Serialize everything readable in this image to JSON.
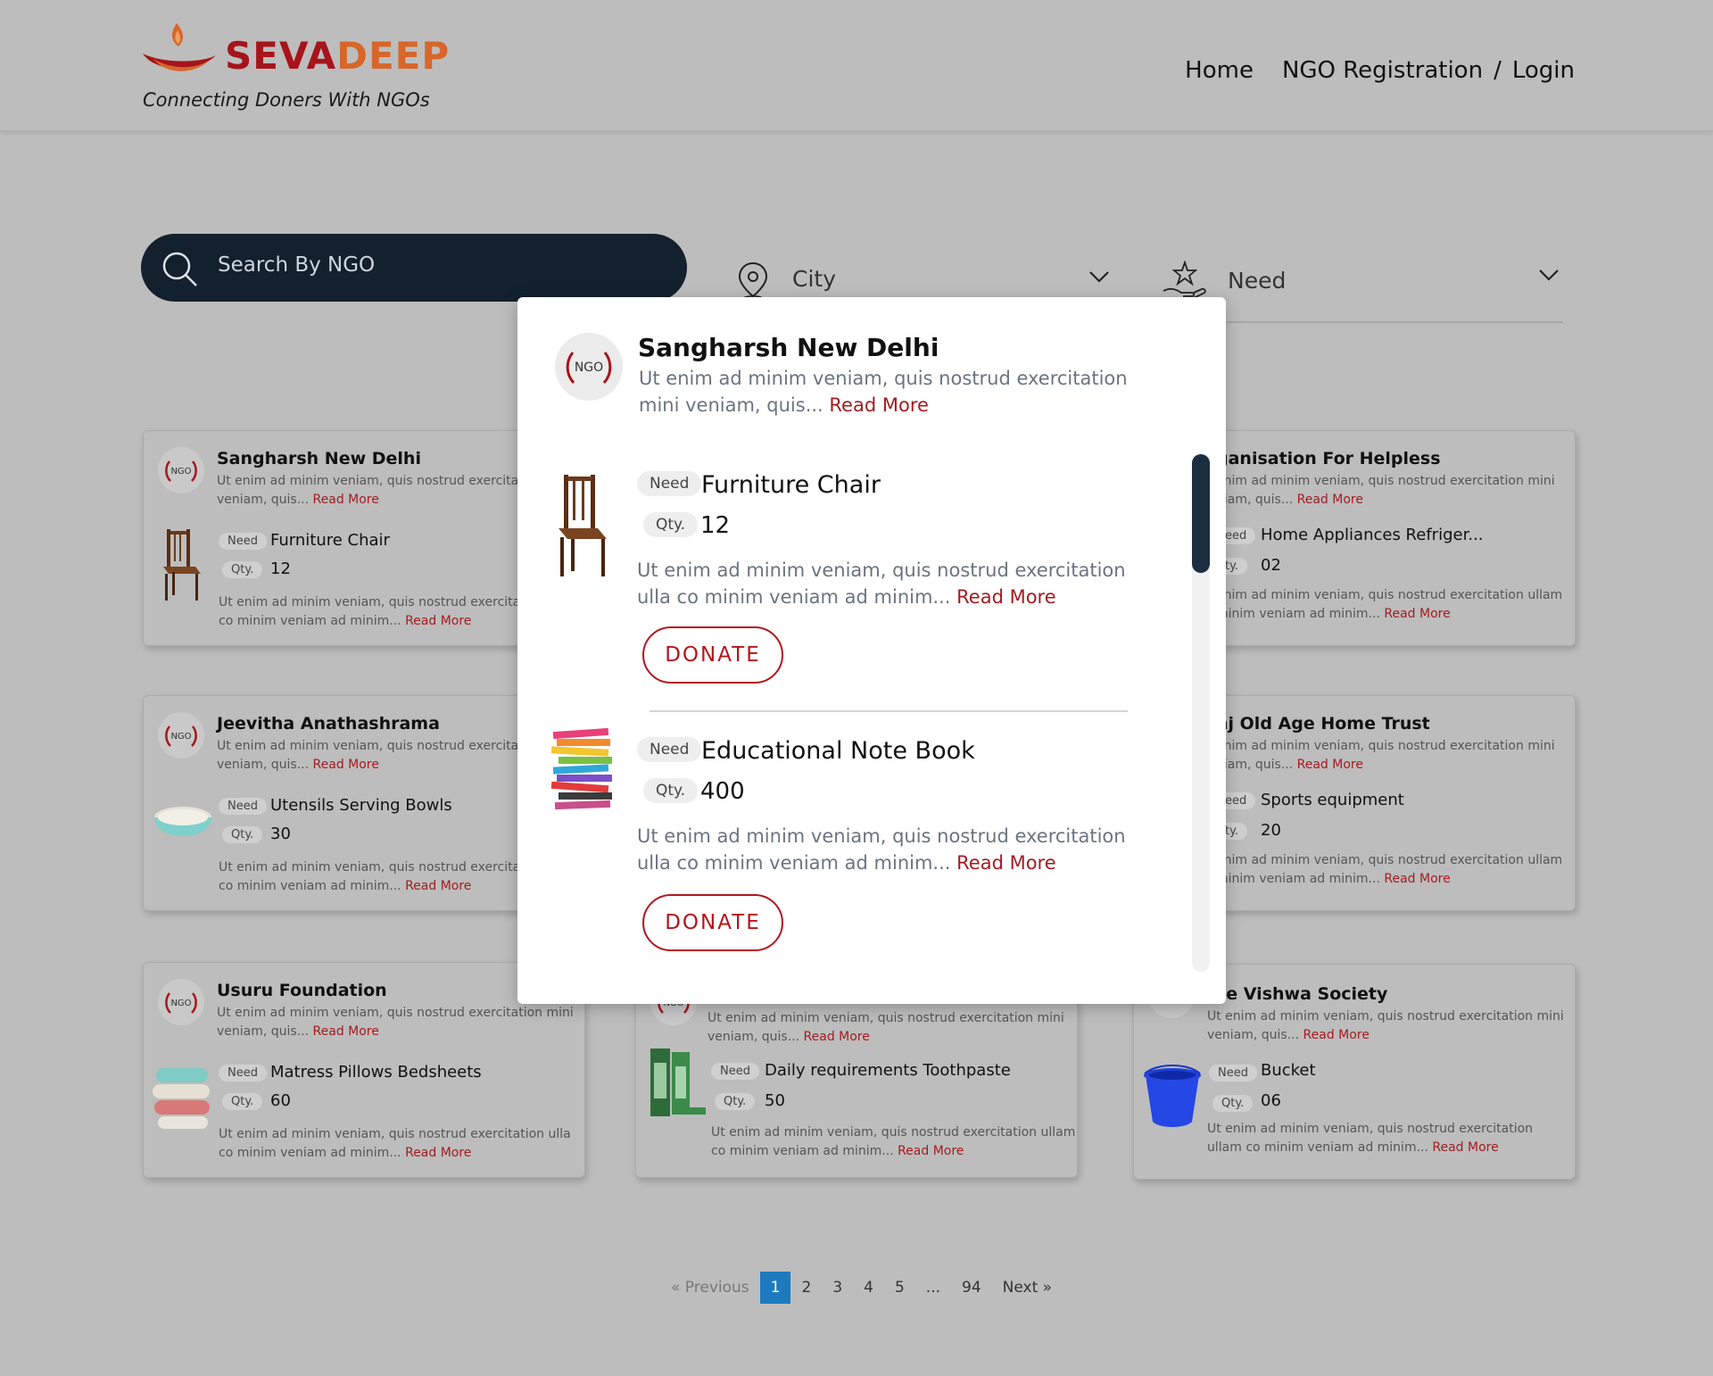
{
  "brand": {
    "word_a": "SEVA",
    "word_b": "DEEP",
    "tagline": "Connecting Doners With NGOs",
    "color_a": "#a7141b",
    "color_b": "#d7662a"
  },
  "nav": {
    "home": "Home",
    "register": "NGO Registration",
    "separator": "/",
    "login": "Login"
  },
  "search": {
    "placeholder": "Search By NGO",
    "icon": "search-icon"
  },
  "filters": {
    "city": "City",
    "need": "Need"
  },
  "badge_text": "NGO",
  "cards": [
    {
      "ngo": "Sangharsh New Delhi",
      "desc": "Ut enim ad minim veniam, quis nostrud exercitation mini veniam, quis...",
      "read_more": "Read More",
      "need_tag": "Need",
      "qty_tag": "Qty.",
      "item": "Furniture Chair",
      "qty": "12",
      "item_desc": "Ut enim ad minim veniam, quis nostrud exercitation ulla co minim veniam ad minim...",
      "item_read_more": "Read More"
    },
    {
      "ngo": "Jeevitha Anathashrama",
      "desc": "Ut enim ad minim veniam, quis nostrud exercitation mini veniam, quis...",
      "read_more": "Read More",
      "need_tag": "Need",
      "qty_tag": "Qty.",
      "item": "Utensils Serving Bowls",
      "qty": "30",
      "item_desc": "Ut enim ad minim veniam, quis nostrud exercitation ulla co minim veniam ad minim...",
      "item_read_more": "Read More"
    },
    {
      "ngo": "Usuru Foundation",
      "desc": "Ut enim ad minim veniam, quis nostrud exercitation mini veniam, quis...",
      "read_more": "Read More",
      "need_tag": "Need",
      "qty_tag": "Qty.",
      "item": "Matress Pillows Bedsheets",
      "qty": "60",
      "item_desc": "Ut enim ad minim veniam, quis nostrud exercitation ulla co minim veniam ad minim...",
      "item_read_more": "Read More"
    },
    {
      "ngo": "",
      "desc": "Ut enim ad minim veniam, quis nostrud exercitation mini veniam, quis...",
      "read_more": "Read More",
      "need_tag": "Need",
      "qty_tag": "Qty.",
      "item": "Daily requirements Toothpaste",
      "qty": "50",
      "item_desc": "Ut enim ad minim veniam, quis nostrud exercitation ullam co minim veniam ad minim...",
      "item_read_more": "Read More"
    },
    {
      "ngo": "ganisation For Helpless",
      "desc": "enim ad minim veniam, quis nostrud exercitation mini niam, quis...",
      "read_more": "Read More",
      "need_tag": "eed",
      "qty_tag": "ty.",
      "item": "Home Appliances Refriger...",
      "qty": "02",
      "item_desc": "enim ad minim veniam, quis nostrud exercitation ullam minim veniam ad minim...",
      "item_read_more": "Read More"
    },
    {
      "ngo": "nj Old Age Home Trust",
      "desc": "enim ad minim veniam, quis nostrud exercitation mini niam, quis...",
      "read_more": "Read More",
      "need_tag": "eed",
      "qty_tag": "ty.",
      "item": "Sports equipment",
      "qty": "20",
      "item_desc": "enim ad minim veniam, quis nostrud exercitation ullam minim veniam ad minim...",
      "item_read_more": "Read More"
    },
    {
      "ngo": "se Vishwa Society",
      "desc": "Ut enim ad minim veniam, quis nostrud exercitation mini veniam, quis...",
      "read_more": "Read More",
      "need_tag": "Need",
      "qty_tag": "Qty.",
      "item": "Bucket",
      "qty": "06",
      "item_desc": "Ut enim ad minim veniam, quis nostrud exercitation ullam co minim veniam ad minim...",
      "item_read_more": "Read More"
    }
  ],
  "pagination": {
    "prev": "«  Previous",
    "pages": [
      "1",
      "2",
      "3",
      "4",
      "5",
      "...",
      "94"
    ],
    "current": "1",
    "next": "Next  »"
  },
  "modal": {
    "ngo": "Sangharsh New Delhi",
    "desc": "Ut enim ad minim veniam, quis nostrud exercitation mini veniam, quis...",
    "read_more": "Read More",
    "items": [
      {
        "need_tag": "Need",
        "qty_tag": "Qty.",
        "name": "Furniture Chair",
        "qty": "12",
        "desc": "Ut enim ad minim veniam, quis nostrud exercitation ulla co minim veniam ad minim...",
        "read_more": "Read More",
        "donate": "DONATE"
      },
      {
        "need_tag": "Need",
        "qty_tag": "Qty.",
        "name": "Educational Note Book",
        "qty": "400",
        "desc": "Ut enim ad minim veniam, quis nostrud exercitation ulla co minim veniam ad minim...",
        "read_more": "Read More",
        "donate": "DONATE"
      }
    ]
  }
}
